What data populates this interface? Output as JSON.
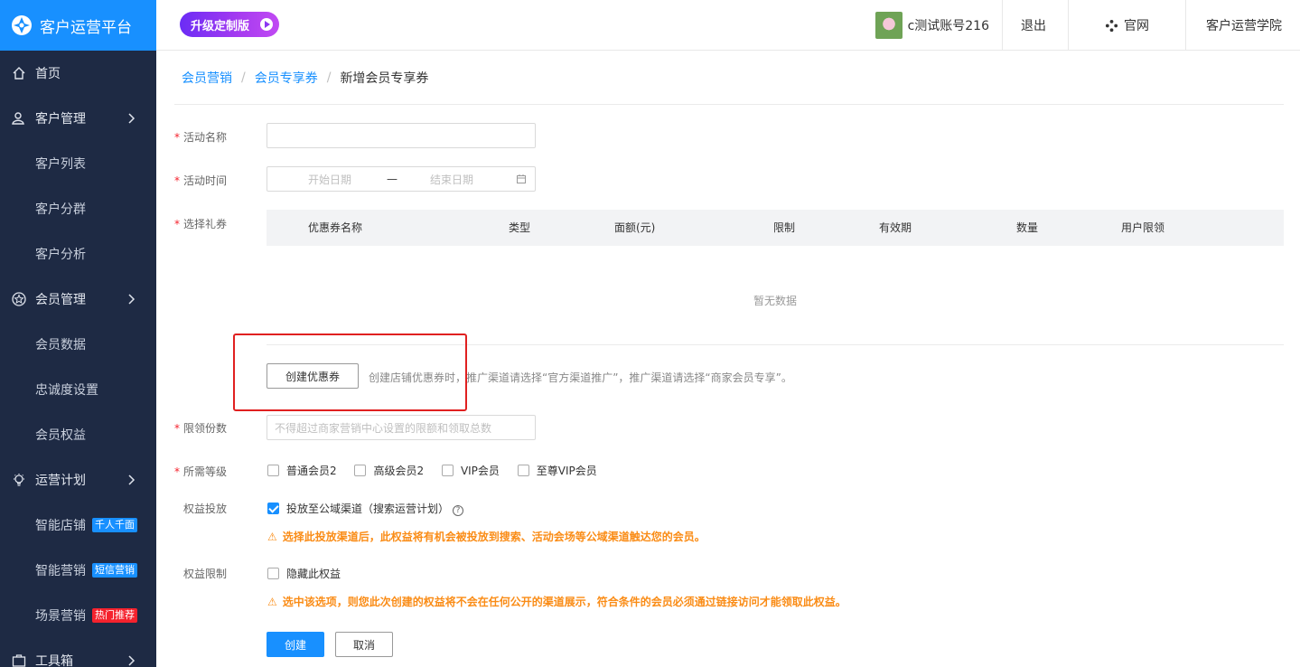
{
  "sidebar": {
    "brand": "客户运营平台",
    "items": [
      {
        "label": "首页",
        "icon": "home-icon"
      },
      {
        "label": "客户管理",
        "icon": "user-icon"
      },
      {
        "label": "客户列表"
      },
      {
        "label": "客户分群"
      },
      {
        "label": "客户分析"
      },
      {
        "label": "会员管理",
        "icon": "star-icon"
      },
      {
        "label": "会员数据"
      },
      {
        "label": "忠诚度设置"
      },
      {
        "label": "会员权益"
      },
      {
        "label": "运营计划",
        "icon": "bulb-icon"
      },
      {
        "label": "智能店铺",
        "badge": "千人千面",
        "badge_color": "#1890ff"
      },
      {
        "label": "智能营销",
        "badge": "短信营销",
        "badge_color": "#1890ff"
      },
      {
        "label": "场景营销",
        "badge": "热门推荐",
        "badge_color": "#f5222d"
      },
      {
        "label": "工具箱",
        "icon": "toolbox-icon"
      }
    ]
  },
  "header": {
    "upgrade_label": "升级定制版",
    "account": "c测试账号216",
    "logout": "退出",
    "official_site": "官网",
    "academy": "客户运营学院"
  },
  "breadcrumb": {
    "items": [
      "会员营销",
      "会员专享券"
    ],
    "current": "新增会员专享券"
  },
  "form": {
    "activity_name": {
      "label": "活动名称",
      "value": ""
    },
    "activity_time": {
      "label": "活动时间",
      "start_placeholder": "开始日期",
      "separator": "—",
      "end_placeholder": "结束日期"
    },
    "coupon": {
      "label": "选择礼券",
      "columns": [
        "优惠券名称",
        "类型",
        "面额(元)",
        "限制",
        "有效期",
        "数量",
        "用户限领"
      ],
      "empty_text": "暂无数据",
      "create_button": "创建优惠券",
      "hint": "创建店铺优惠券时，推广渠道请选择“官方渠道推广”，推广渠道请选择“商家会员专享”。"
    },
    "limit_count": {
      "label": "限领份数",
      "placeholder": "不得超过商家营销中心设置的限额和领取总数"
    },
    "levels": {
      "label": "所需等级",
      "options": [
        "普通会员2",
        "高级会员2",
        "VIP会员",
        "至尊VIP会员"
      ]
    },
    "delivery": {
      "label": "权益投放",
      "option": "投放至公域渠道（搜索运营计划）",
      "checked": true,
      "warning": "选择此投放渠道后，此权益将有机会被投放到搜索、活动会场等公域渠道触达您的会员。"
    },
    "restriction": {
      "label": "权益限制",
      "option": "隐藏此权益",
      "checked": false,
      "warning": "选中该选项，则您此次创建的权益将不会在任何公开的渠道展示，符合条件的会员必须通过链接访问才能领取此权益。"
    },
    "submit": "创建",
    "cancel": "取消"
  },
  "colors": {
    "accent": "#1890ff",
    "sidebar": "#1e2a44",
    "warning": "#fa8c16",
    "required": "#f5222d",
    "highlight": "#e02020"
  }
}
